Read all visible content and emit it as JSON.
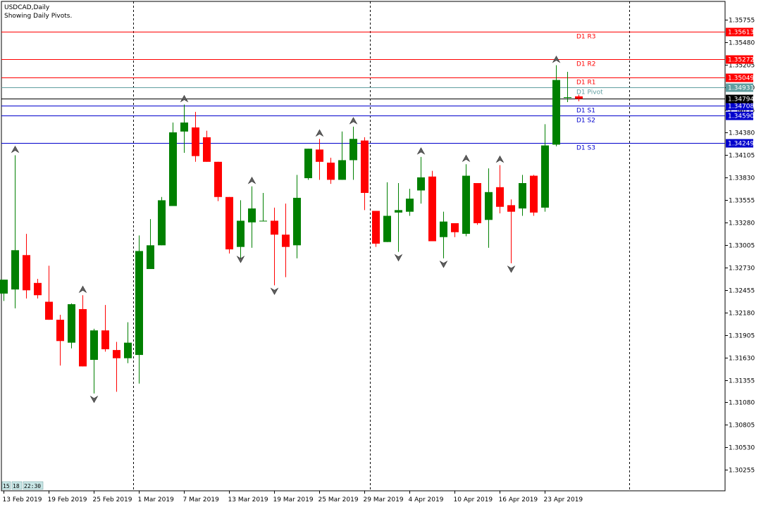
{
  "window": {
    "symbol_title": "USDCAD,Daily",
    "subtitle": "Showing Daily Pivots.",
    "timer": {
      "h": "15",
      "m": "18",
      "s": "22:30"
    }
  },
  "colors": {
    "bull": "#008000",
    "bear": "#ff0000",
    "resistance": "#ff0000",
    "support": "#0000cc",
    "pivot": "#5f9ea0",
    "current_price": "#000000",
    "axis": "#000000",
    "separator": "#000000"
  },
  "chart_data": {
    "type": "candlestick",
    "symbol": "USDCAD",
    "timeframe": "Daily",
    "ylim": [
      1.3,
      1.3598
    ],
    "y_ticks": [
      "1.35755",
      "1.35480",
      "1.35205",
      "1.34930",
      "1.34655",
      "1.34380",
      "1.34105",
      "1.33830",
      "1.33555",
      "1.33280",
      "1.33005",
      "1.32730",
      "1.32455",
      "1.32180",
      "1.31905",
      "1.31630",
      "1.31355",
      "1.31080",
      "1.30805",
      "1.30530",
      "1.30255"
    ],
    "x_labels": [
      {
        "bar": 0,
        "text": "13 Feb 2019"
      },
      {
        "bar": 4,
        "text": "19 Feb 2019"
      },
      {
        "bar": 8,
        "text": "25 Feb 2019"
      },
      {
        "bar": 12,
        "text": "1 Mar 2019"
      },
      {
        "bar": 16,
        "text": "7 Mar 2019"
      },
      {
        "bar": 20,
        "text": "13 Mar 2019"
      },
      {
        "bar": 24,
        "text": "19 Mar 2019"
      },
      {
        "bar": 28,
        "text": "25 Mar 2019"
      },
      {
        "bar": 32,
        "text": "29 Mar 2019"
      },
      {
        "bar": 36,
        "text": "4 Apr 2019"
      },
      {
        "bar": 40,
        "text": "10 Apr 2019"
      },
      {
        "bar": 44,
        "text": "16 Apr 2019"
      },
      {
        "bar": 48,
        "text": "23 Apr 2019"
      }
    ],
    "separators_at_bar": [
      11.5,
      32.5,
      55.5
    ],
    "pivot_levels": [
      {
        "name": "D1 R3",
        "value": 1.35613,
        "role": "resistance"
      },
      {
        "name": "D1 R2",
        "value": 1.35272,
        "role": "resistance"
      },
      {
        "name": "D1 R1",
        "value": 1.35049,
        "role": "resistance"
      },
      {
        "name": "D1 Pivot",
        "value": 1.34931,
        "role": "pivot"
      },
      {
        "name": "D1 S1",
        "value": 1.34708,
        "role": "support"
      },
      {
        "name": "D1 S2",
        "value": 1.3459,
        "role": "support"
      },
      {
        "name": "D1 S3",
        "value": 1.34249,
        "role": "support"
      }
    ],
    "current_price": {
      "value": 1.34794,
      "text": "1.34794"
    },
    "candles": [
      {
        "o": 1.3241,
        "h": 1.3258,
        "l": 1.3232,
        "c": 1.3258
      },
      {
        "o": 1.3246,
        "h": 1.341,
        "l": 1.3223,
        "c": 1.3294
      },
      {
        "o": 1.3288,
        "h": 1.3314,
        "l": 1.3235,
        "c": 1.3245
      },
      {
        "o": 1.3254,
        "h": 1.3259,
        "l": 1.3235,
        "c": 1.3239
      },
      {
        "o": 1.3231,
        "h": 1.3275,
        "l": 1.3209,
        "c": 1.3209
      },
      {
        "o": 1.3209,
        "h": 1.3215,
        "l": 1.3153,
        "c": 1.3183
      },
      {
        "o": 1.3181,
        "h": 1.3229,
        "l": 1.3174,
        "c": 1.3228
      },
      {
        "o": 1.3222,
        "h": 1.3239,
        "l": 1.3152,
        "c": 1.3152
      },
      {
        "o": 1.316,
        "h": 1.3198,
        "l": 1.3119,
        "c": 1.3196
      },
      {
        "o": 1.3196,
        "h": 1.3227,
        "l": 1.317,
        "c": 1.3173
      },
      {
        "o": 1.3172,
        "h": 1.3182,
        "l": 1.3121,
        "c": 1.3162
      },
      {
        "o": 1.3162,
        "h": 1.3206,
        "l": 1.3156,
        "c": 1.3181
      },
      {
        "o": 1.3166,
        "h": 1.3312,
        "l": 1.3131,
        "c": 1.3293
      },
      {
        "o": 1.3271,
        "h": 1.3332,
        "l": 1.3271,
        "c": 1.33
      },
      {
        "o": 1.33,
        "h": 1.3359,
        "l": 1.33,
        "c": 1.3355
      },
      {
        "o": 1.3348,
        "h": 1.345,
        "l": 1.3348,
        "c": 1.3438
      },
      {
        "o": 1.3439,
        "h": 1.3472,
        "l": 1.3413,
        "c": 1.345
      },
      {
        "o": 1.3444,
        "h": 1.3463,
        "l": 1.3402,
        "c": 1.3409
      },
      {
        "o": 1.3432,
        "h": 1.344,
        "l": 1.3402,
        "c": 1.3402
      },
      {
        "o": 1.3402,
        "h": 1.3402,
        "l": 1.3354,
        "c": 1.3359
      },
      {
        "o": 1.3359,
        "h": 1.3359,
        "l": 1.329,
        "c": 1.3295
      },
      {
        "o": 1.3298,
        "h": 1.3355,
        "l": 1.3282,
        "c": 1.333
      },
      {
        "o": 1.3328,
        "h": 1.3372,
        "l": 1.3297,
        "c": 1.3345
      },
      {
        "o": 1.333,
        "h": 1.3364,
        "l": 1.333,
        "c": 1.333
      },
      {
        "o": 1.333,
        "h": 1.3346,
        "l": 1.3251,
        "c": 1.3313
      },
      {
        "o": 1.3313,
        "h": 1.3351,
        "l": 1.3261,
        "c": 1.3298
      },
      {
        "o": 1.33,
        "h": 1.3386,
        "l": 1.3284,
        "c": 1.3358
      },
      {
        "o": 1.3382,
        "h": 1.3418,
        "l": 1.338,
        "c": 1.3418
      },
      {
        "o": 1.3417,
        "h": 1.343,
        "l": 1.338,
        "c": 1.3402
      },
      {
        "o": 1.3401,
        "h": 1.3407,
        "l": 1.3375,
        "c": 1.338
      },
      {
        "o": 1.338,
        "h": 1.3439,
        "l": 1.338,
        "c": 1.3404
      },
      {
        "o": 1.3404,
        "h": 1.3445,
        "l": 1.338,
        "c": 1.343
      },
      {
        "o": 1.3428,
        "h": 1.3432,
        "l": 1.3343,
        "c": 1.3364
      },
      {
        "o": 1.3342,
        "h": 1.3342,
        "l": 1.3298,
        "c": 1.3302
      },
      {
        "o": 1.3304,
        "h": 1.3377,
        "l": 1.3304,
        "c": 1.3336
      },
      {
        "o": 1.334,
        "h": 1.3376,
        "l": 1.3292,
        "c": 1.3343
      },
      {
        "o": 1.3341,
        "h": 1.3369,
        "l": 1.3336,
        "c": 1.3357
      },
      {
        "o": 1.3367,
        "h": 1.3408,
        "l": 1.3351,
        "c": 1.3383
      },
      {
        "o": 1.3384,
        "h": 1.3391,
        "l": 1.3305,
        "c": 1.3305
      },
      {
        "o": 1.331,
        "h": 1.3341,
        "l": 1.3284,
        "c": 1.3329
      },
      {
        "o": 1.3327,
        "h": 1.332,
        "l": 1.331,
        "c": 1.3316
      },
      {
        "o": 1.3314,
        "h": 1.3399,
        "l": 1.3311,
        "c": 1.3385
      },
      {
        "o": 1.3376,
        "h": 1.3376,
        "l": 1.3325,
        "c": 1.3327
      },
      {
        "o": 1.3331,
        "h": 1.3394,
        "l": 1.3297,
        "c": 1.3365
      },
      {
        "o": 1.3371,
        "h": 1.3398,
        "l": 1.3339,
        "c": 1.3347
      },
      {
        "o": 1.3349,
        "h": 1.3356,
        "l": 1.3278,
        "c": 1.3341
      },
      {
        "o": 1.3345,
        "h": 1.3386,
        "l": 1.3336,
        "c": 1.3376
      },
      {
        "o": 1.3385,
        "h": 1.3386,
        "l": 1.3336,
        "c": 1.334
      },
      {
        "o": 1.3346,
        "h": 1.3448,
        "l": 1.3341,
        "c": 1.3422
      },
      {
        "o": 1.3423,
        "h": 1.352,
        "l": 1.3421,
        "c": 1.3502
      },
      {
        "o": 1.348,
        "h": 1.3512,
        "l": 1.3475,
        "c": 1.3481
      },
      {
        "o": 1.3482,
        "h": 1.3484,
        "l": 1.3476,
        "c": 1.3479
      }
    ],
    "fractals": [
      {
        "bar": 1,
        "dir": "up",
        "value": 1.341
      },
      {
        "bar": 7,
        "dir": "up",
        "value": 1.3239
      },
      {
        "bar": 16,
        "dir": "up",
        "value": 1.3472
      },
      {
        "bar": 22,
        "dir": "up",
        "value": 1.3372
      },
      {
        "bar": 28,
        "dir": "up",
        "value": 1.343
      },
      {
        "bar": 31,
        "dir": "up",
        "value": 1.3445
      },
      {
        "bar": 37,
        "dir": "up",
        "value": 1.3408
      },
      {
        "bar": 41,
        "dir": "up",
        "value": 1.3399
      },
      {
        "bar": 44,
        "dir": "up",
        "value": 1.3398
      },
      {
        "bar": 49,
        "dir": "up",
        "value": 1.352
      },
      {
        "bar": 8,
        "dir": "down",
        "value": 1.3119
      },
      {
        "bar": 21,
        "dir": "down",
        "value": 1.329
      },
      {
        "bar": 24,
        "dir": "down",
        "value": 1.3251
      },
      {
        "bar": 35,
        "dir": "down",
        "value": 1.3292
      },
      {
        "bar": 39,
        "dir": "down",
        "value": 1.3284
      },
      {
        "bar": 45,
        "dir": "down",
        "value": 1.3278
      }
    ]
  }
}
